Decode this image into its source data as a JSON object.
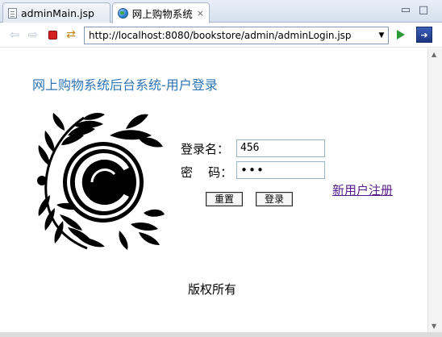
{
  "tabs": [
    {
      "label": "adminMain.jsp",
      "icon": "jsp-file-icon"
    },
    {
      "label": "网上购物系统",
      "icon": "globe-icon",
      "close": "⨯"
    }
  ],
  "toolbar": {
    "url": "http://localhost:8080/bookstore/admin/adminLogin.jsp"
  },
  "page": {
    "title": "网上购物系统后台系统-用户登录",
    "form": {
      "username_label": "登录名：",
      "username_value": "456",
      "password_label": "密    码：",
      "password_value": "•••",
      "reset_label": "重置",
      "login_label": "登录"
    },
    "register_link": "新用户注册",
    "footer": "版权所有"
  },
  "colors": {
    "title": "#2e74b5",
    "link": "#551a8b"
  }
}
